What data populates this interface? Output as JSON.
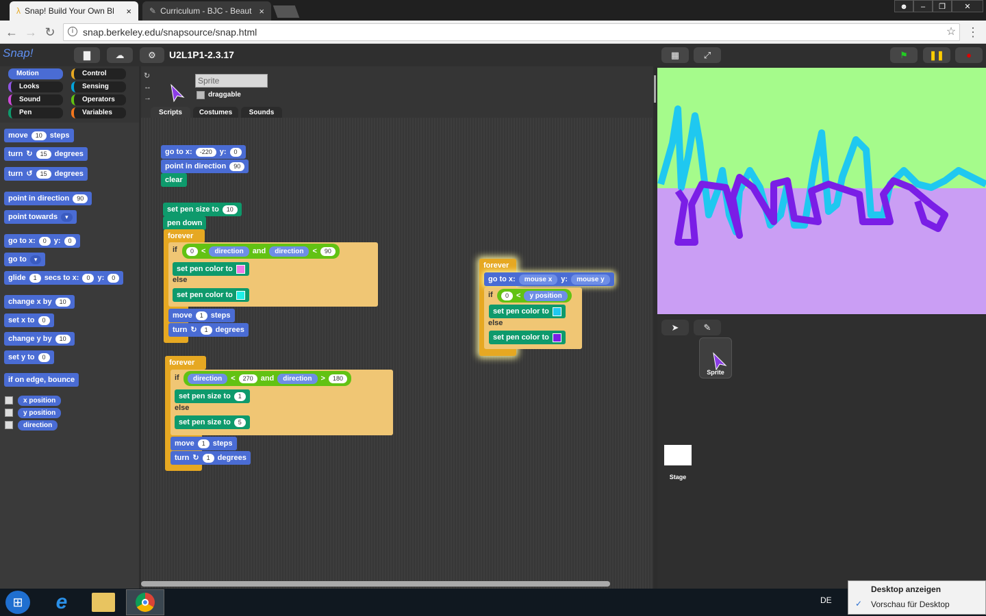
{
  "browser": {
    "tabs": [
      {
        "label": "Snap! Build Your Own Bl",
        "close": "×"
      },
      {
        "label": "Curriculum - BJC - Beaut",
        "close": "×"
      }
    ],
    "url": "snap.berkeley.edu/snapsource/snap.html",
    "taskbar_lang": "DE",
    "popup": {
      "title": "Desktop anzeigen",
      "item": "Vorschau für Desktop"
    }
  },
  "snap": {
    "logo": "Snap!",
    "project_name": "U2L1P1-2.3.17",
    "categories": [
      "Motion",
      "Control",
      "Looks",
      "Sensing",
      "Sound",
      "Operators",
      "Pen",
      "Variables"
    ],
    "sprite_name": "Sprite",
    "draggable_label": "draggable",
    "tabs": [
      "Scripts",
      "Costumes",
      "Sounds"
    ],
    "palette": {
      "move": "move",
      "steps": "steps",
      "turn": "turn",
      "degrees": "degrees",
      "point_dir": "point in direction",
      "point_towards": "point towards",
      "go_to_xy": "go to x:",
      "y": "y:",
      "go_to": "go to",
      "glide": "glide",
      "secs_to_x": "secs to x:",
      "change_x": "change x by",
      "set_x": "set x to",
      "change_y": "change y by",
      "set_y": "set y to",
      "bounce": "if on edge, bounce",
      "x_position": "x position",
      "y_position": "y position",
      "direction": "direction",
      "v10": "10",
      "v15": "15",
      "v90": "90",
      "v0": "0",
      "v1": "1"
    },
    "script1": {
      "goto": "go to x:",
      "x": "-220",
      "y_label": "y:",
      "y": "0",
      "point": "point in direction",
      "dir": "90",
      "clear": "clear"
    },
    "script2": {
      "set_size": "set pen size to",
      "size": "10",
      "pen_down": "pen down",
      "forever": "forever",
      "if": "if",
      "zero": "0",
      "lt": "<",
      "direction": "direction",
      "and": "and",
      "ninety": "90",
      "set_color": "set pen color to",
      "else": "else",
      "move": "move",
      "one": "1",
      "steps": "steps",
      "turn": "turn",
      "degrees": "degrees"
    },
    "script3": {
      "forever": "forever",
      "if": "if",
      "direction": "direction",
      "lt": "<",
      "v270": "270",
      "and": "and",
      "gt": ">",
      "v180": "180",
      "set_size": "set pen size to",
      "s1": "1",
      "else": "else",
      "s5": "5",
      "move": "move",
      "one": "1",
      "steps": "steps",
      "turn": "turn",
      "degrees": "degrees"
    },
    "script4": {
      "forever": "forever",
      "goto": "go to x:",
      "mouse_x": "mouse x",
      "y_label": "y:",
      "mouse_y": "mouse y",
      "if": "if",
      "zero": "0",
      "lt": "<",
      "y_position": "y position",
      "set_color": "set pen color to",
      "else": "else"
    },
    "corral": {
      "sprite": "Sprite",
      "stage": "Stage"
    }
  },
  "colors": {
    "stage_top": "#a5fb8b",
    "stage_bottom": "#ca9ef4",
    "pen_cyan": "#1fc8f0",
    "pen_purple": "#7a1ee6"
  }
}
